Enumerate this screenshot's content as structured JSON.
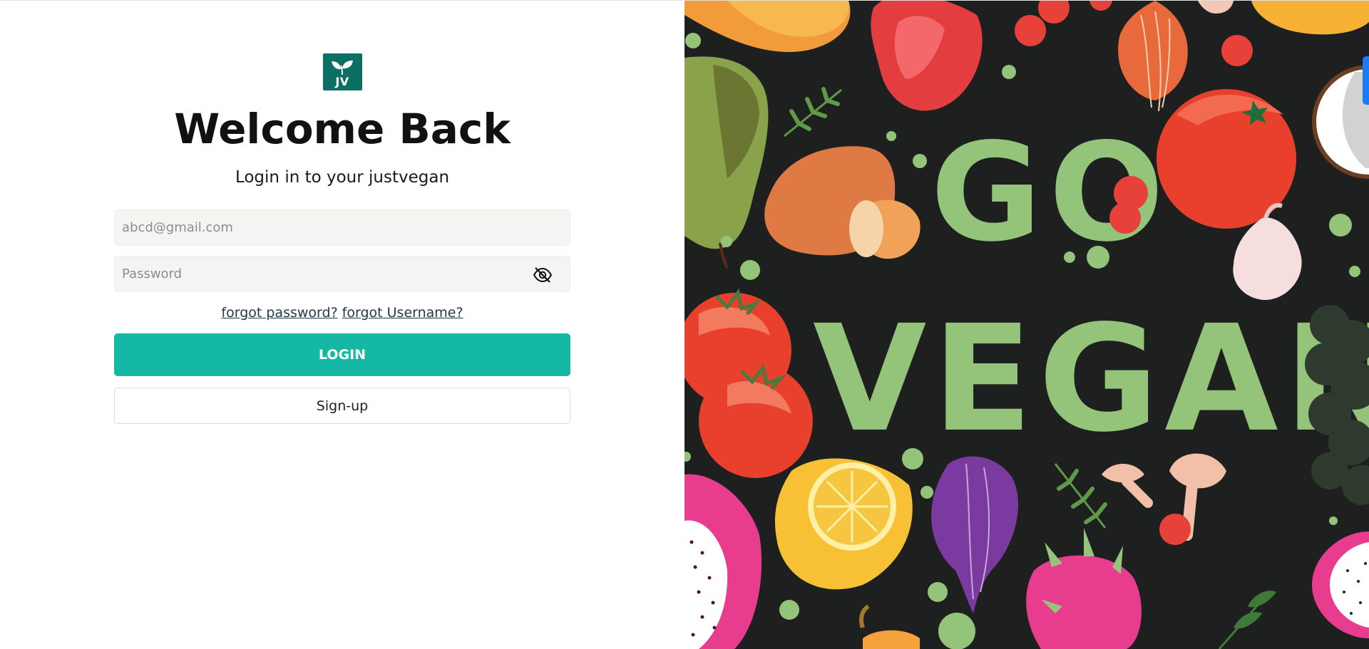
{
  "logo": {
    "text": "JV",
    "icon": "leaf-sprout-icon",
    "color": "#0c6f63"
  },
  "heading": {
    "title": "Welcome Back",
    "subtitle": "Login in to your justvegan"
  },
  "form": {
    "email_placeholder": "abcd@gmail.com",
    "email_value": "",
    "password_placeholder": "Password",
    "password_value": "",
    "toggle_icon": "eye-slash-icon",
    "forgot_password": "forgot password?",
    "forgot_username": "forgot Username?",
    "login_label": "LOGIN",
    "signup_label": "Sign-up"
  },
  "artwork": {
    "line1": "GO",
    "line2": "VEGAN"
  },
  "colors": {
    "accent": "#15b8a5",
    "art_background": "#1e201f",
    "art_text": "#94c47a"
  }
}
